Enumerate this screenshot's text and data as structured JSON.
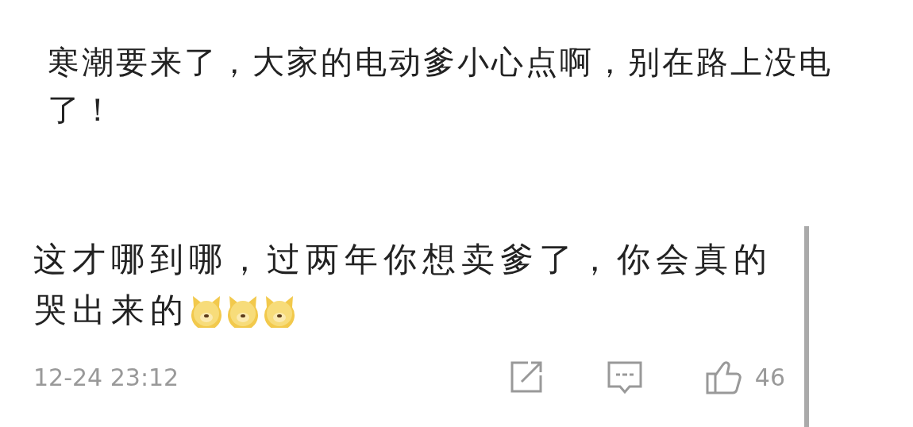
{
  "quoted_post": {
    "text": "寒潮要来了，大家的电动爹小心点啊，别在路上没电了！"
  },
  "reply": {
    "lines": [
      "这才哪到哪，过两年你想卖爹了，你会真的",
      "哭出来的"
    ],
    "emojis": [
      {
        "kind": "dog"
      },
      {
        "kind": "dog"
      },
      {
        "kind": "dog"
      }
    ],
    "time": "12-24 23:12",
    "likes": "46"
  }
}
